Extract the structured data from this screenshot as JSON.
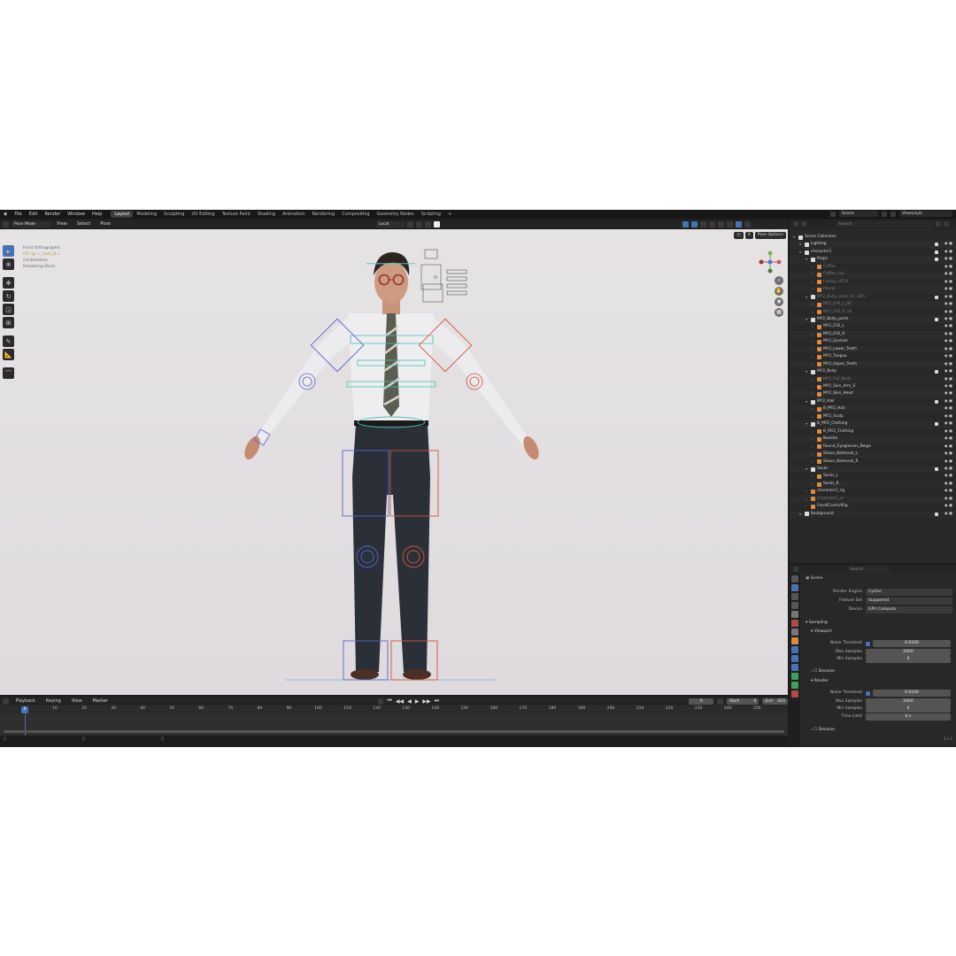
{
  "menu": [
    "File",
    "Edit",
    "Render",
    "Window",
    "Help"
  ],
  "workspaces": [
    "Layout",
    "Modeling",
    "Sculpting",
    "UV Editing",
    "Texture Paint",
    "Shading",
    "Animation",
    "Rendering",
    "Compositing",
    "Geometry Nodes",
    "Scripting"
  ],
  "active_workspace": "Layout",
  "scene_name": "Scene",
  "view_layer": "ViewLayer",
  "viewport_header": {
    "mode": "Pose Mode",
    "menus": [
      "View",
      "Select",
      "Pose"
    ],
    "transform_orientation": "Local",
    "pose_options": "Pose Options"
  },
  "viewport_overlay": {
    "line1": "Front Orthographic",
    "line2": "(0) rig : c_foot_fk.l",
    "line3": "Centimeters",
    "line4": "Rendering Done"
  },
  "timeline": {
    "menus": [
      "Playback",
      "Keying",
      "View",
      "Marker"
    ],
    "current_frame": "0",
    "start_label": "Start",
    "start": "0",
    "end_label": "End",
    "end": "410",
    "ticks": [
      "0",
      "10",
      "20",
      "30",
      "40",
      "50",
      "60",
      "70",
      "80",
      "90",
      "100",
      "110",
      "120",
      "130",
      "140",
      "150",
      "160",
      "170",
      "180",
      "190",
      "200",
      "210",
      "220",
      "230",
      "240",
      "250"
    ]
  },
  "outliner": {
    "search_placeholder": "Search",
    "rows": [
      {
        "name": "Scene Collection",
        "depth": 0,
        "type": "scene"
      },
      {
        "name": "Lighting",
        "depth": 1,
        "type": "coll"
      },
      {
        "name": "character1",
        "depth": 1,
        "type": "coll"
      },
      {
        "name": "Props",
        "depth": 2,
        "type": "coll"
      },
      {
        "name": "Coffee",
        "depth": 3,
        "type": "obj",
        "dim": true
      },
      {
        "name": "Coffee_cup",
        "depth": 3,
        "type": "obj",
        "dim": true
      },
      {
        "name": "Laptop_HP20",
        "depth": 3,
        "type": "obj",
        "dim": true
      },
      {
        "name": "Phone",
        "depth": 3,
        "type": "obj",
        "dim": true
      },
      {
        "name": "MY2_Body_parts_for_UE5",
        "depth": 2,
        "type": "coll",
        "dim": true
      },
      {
        "name": "MY2_EYE_L_UE",
        "depth": 3,
        "type": "obj",
        "dim": true
      },
      {
        "name": "MY2_EYE_R_UE",
        "depth": 3,
        "type": "obj",
        "dim": true
      },
      {
        "name": "MY2_Body_parts",
        "depth": 2,
        "type": "coll"
      },
      {
        "name": "MY2_EYE_L",
        "depth": 3,
        "type": "obj"
      },
      {
        "name": "MY2_EYE_R",
        "depth": 3,
        "type": "obj"
      },
      {
        "name": "MY2_Eyelash",
        "depth": 3,
        "type": "obj"
      },
      {
        "name": "MY2_Lower_Teeth",
        "depth": 3,
        "type": "obj"
      },
      {
        "name": "MY2_Tongue",
        "depth": 3,
        "type": "obj"
      },
      {
        "name": "MY2_Upper_Teeth",
        "depth": 3,
        "type": "obj"
      },
      {
        "name": "MY2_Body",
        "depth": 2,
        "type": "coll"
      },
      {
        "name": "MY2_Full_Body",
        "depth": 3,
        "type": "obj",
        "dim": true
      },
      {
        "name": "MY2_Skin_Arm_S",
        "depth": 3,
        "type": "obj"
      },
      {
        "name": "MY2_Skin_Head",
        "depth": 3,
        "type": "obj"
      },
      {
        "name": "MY2_Hair",
        "depth": 2,
        "type": "coll"
      },
      {
        "name": "B_MY2_Hair",
        "depth": 3,
        "type": "obj"
      },
      {
        "name": "MY2_Scalp",
        "depth": 3,
        "type": "obj"
      },
      {
        "name": "B_MY2_Clothing",
        "depth": 2,
        "type": "coll"
      },
      {
        "name": "B_MY2_Clothing",
        "depth": 3,
        "type": "obj"
      },
      {
        "name": "Necktie",
        "depth": 3,
        "type": "obj"
      },
      {
        "name": "Round_Eyeglasses_Beige",
        "depth": 3,
        "type": "obj"
      },
      {
        "name": "Shoes_Balmoral_L",
        "depth": 3,
        "type": "obj"
      },
      {
        "name": "Shoes_Balmoral_R",
        "depth": 3,
        "type": "obj"
      },
      {
        "name": "Socks",
        "depth": 2,
        "type": "coll"
      },
      {
        "name": "Socks_L",
        "depth": 3,
        "type": "obj"
      },
      {
        "name": "Socks_R",
        "depth": 3,
        "type": "obj"
      },
      {
        "name": "character1_rig",
        "depth": 2,
        "type": "obj"
      },
      {
        "name": "character1_cs",
        "depth": 2,
        "type": "obj",
        "dim": true
      },
      {
        "name": "FacellControlRig",
        "depth": 2,
        "type": "obj"
      },
      {
        "name": "Background",
        "depth": 1,
        "type": "coll"
      }
    ]
  },
  "properties": {
    "search_placeholder": "Search",
    "breadcrumb": "Scene",
    "render_engine_label": "Render Engine",
    "render_engine": "Cycles",
    "feature_set_label": "Feature Set",
    "feature_set": "Supported",
    "device_label": "Device",
    "device": "GPU Compute",
    "sampling": "Sampling",
    "viewport": "Viewport",
    "vp_noise_threshold_label": "Noise Threshold",
    "vp_noise_threshold": "0.0100",
    "vp_max_samples_label": "Max Samples",
    "vp_max_samples": "2000",
    "vp_min_samples_label": "Min Samples",
    "vp_min_samples": "0",
    "vp_denoise": "Denoise",
    "render": "Render",
    "r_noise_threshold_label": "Noise Threshold",
    "r_noise_threshold": "0.0100",
    "r_max_samples_label": "Max Samples",
    "r_max_samples": "2000",
    "r_min_samples_label": "Min Samples",
    "r_min_samples": "0",
    "r_time_limit_label": "Time Limit",
    "r_time_limit": "0 s",
    "r_denoise": "Denoise"
  },
  "version": "4.1.1",
  "colors": {
    "accent": "#4772b3",
    "viewport_bg": "#e4e1e3",
    "panel": "#282828"
  }
}
